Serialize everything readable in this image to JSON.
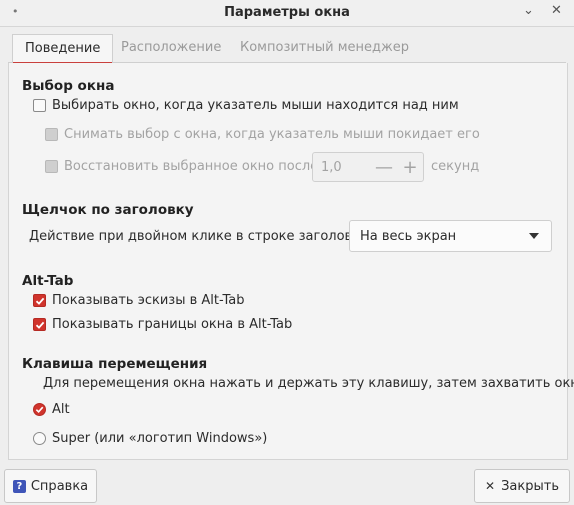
{
  "window": {
    "title": "Параметры окна",
    "menu_icon": "•",
    "minimize_icon": "⌄",
    "close_icon": "✕"
  },
  "tabs": [
    {
      "label": "Поведение",
      "active": true
    },
    {
      "label": "Расположение",
      "active": false
    },
    {
      "label": "Композитный менеджер",
      "active": false
    }
  ],
  "window_selection": {
    "heading": "Выбор окна",
    "focus_follows_mouse": {
      "label": "Выбирать окно, когда указатель мыши находится над ним",
      "checked": false,
      "enabled": true
    },
    "unfocus_on_leave": {
      "label": "Снимать выбор с окна, когда указатель мыши покидает его",
      "checked": false,
      "enabled": false
    },
    "restore_after": {
      "label": "Восстановить выбранное окно после",
      "checked": false,
      "enabled": false,
      "value": "1,0",
      "minus": "—",
      "plus": "+",
      "unit": "секунд"
    }
  },
  "titlebar_click": {
    "heading": "Щелчок по заголовку",
    "double_click_label": "Действие при двойном клике в строке заголовка:",
    "double_click_value": "На весь экран"
  },
  "alt_tab": {
    "heading": "Alt-Tab",
    "show_thumbnails": {
      "label": "Показывать эскизы в Alt-Tab",
      "checked": true
    },
    "show_borders": {
      "label": "Показывать границы окна в Alt-Tab",
      "checked": true
    }
  },
  "move_key": {
    "heading": "Клавиша перемещения",
    "description": "Для перемещения окна нажать и держать эту клавишу, затем захватить окно:",
    "options": [
      {
        "label": "Alt",
        "selected": true
      },
      {
        "label": "Super (или «логотип Windows»)",
        "selected": false
      }
    ]
  },
  "footer": {
    "help_label": "Справка",
    "help_icon": "?",
    "close_label": "Закрыть",
    "close_icon": "✕"
  },
  "colors": {
    "accent": "#d0342c",
    "help_icon": "#3f55b8"
  }
}
